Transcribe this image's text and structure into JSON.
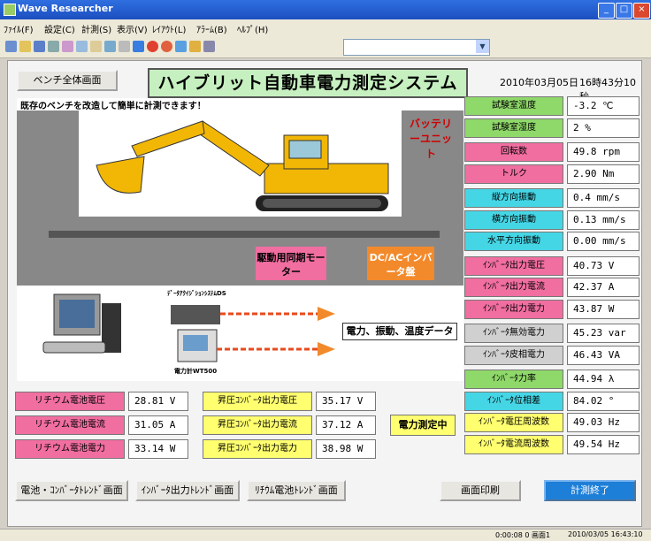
{
  "window": {
    "title": "Wave Researcher",
    "minimize": "_",
    "maximize": "□",
    "close": "×"
  },
  "menu": [
    "ﾌｧｲﾙ(F)",
    "設定(C)",
    "計測(S)",
    "表示(V)",
    "ﾚｲｱｳﾄ(L)",
    "ｱﾗｰﾑ(B)",
    "ﾍﾙﾌﾟ(H)"
  ],
  "toolbar": {
    "combo_arrow": "▼"
  },
  "header": {
    "bench_button": "ベンチ全体画面",
    "system_title": "ハイブリット自動車電力測定システム",
    "date": "2010年03月05日",
    "time": "16時43分10秒"
  },
  "diagram": {
    "caption": "既存のベンチを改造して簡単に計測できます！",
    "battery_label": "バッテリーユニット",
    "motor_label": "駆動用同期モーター",
    "inverter_label": "DC/ACインバータ盤",
    "recorder_label": "ﾃﾞｰﾀｱｸｲｼﾞｼｮﾝｼｽﾃﾑDS",
    "power_meter_label": "電力計WT500",
    "data_label": "電力、振動、温度データ"
  },
  "colors": {
    "pink": "#f06ea0",
    "cyan": "#45d6e6",
    "green": "#8fd86a",
    "yellow": "#ffff70",
    "orange": "#f28a2c",
    "start_button": "#1e7fd8"
  },
  "measurements": [
    {
      "label": "試験室温度",
      "value": "-3.2  ℃",
      "color": "green"
    },
    {
      "label": "試験室湿度",
      "value": "2  %",
      "color": "green"
    },
    {
      "label": "回転数",
      "value": "49.8  rpm",
      "color": "pink"
    },
    {
      "label": "トルク",
      "value": "2.90  Nm",
      "color": "pink"
    },
    {
      "label": "縦方向振動",
      "value": "0.4  mm/s",
      "color": "cyan"
    },
    {
      "label": "横方向振動",
      "value": "0.13  mm/s",
      "color": "cyan"
    },
    {
      "label": "水平方向振動",
      "value": "0.00  mm/s",
      "color": "cyan"
    },
    {
      "label": "ｲﾝﾊﾞｰﾀ出力電圧",
      "value": "40.73  V",
      "color": "pink"
    },
    {
      "label": "ｲﾝﾊﾞｰﾀ出力電流",
      "value": "42.37  A",
      "color": "pink"
    },
    {
      "label": "ｲﾝﾊﾞｰﾀ出力電力",
      "value": "43.87  W",
      "color": "pink"
    },
    {
      "label": "ｲﾝﾊﾞｰﾀ無効電力",
      "value": "45.23  var",
      "color": "grey"
    },
    {
      "label": "ｲﾝﾊﾞｰﾀ皮相電力",
      "value": "46.43  VA",
      "color": "grey"
    },
    {
      "label": "ｲﾝﾊﾞｰﾀ力率",
      "value": "44.94  λ",
      "color": "green"
    },
    {
      "label": "ｲﾝﾊﾞｰﾀ位相差",
      "value": "84.02  °",
      "color": "cyan"
    },
    {
      "label": "ｲﾝﾊﾞｰﾀ電圧周波数",
      "value": "49.03  Hz",
      "color": "yellow"
    },
    {
      "label": "ｲﾝﾊﾞｰﾀ電流周波数",
      "value": "49.54  Hz",
      "color": "yellow"
    }
  ],
  "battery_values": [
    {
      "label": "リチウム電池電圧",
      "value": "28.81  V"
    },
    {
      "label": "リチウム電池電流",
      "value": "31.05  A"
    },
    {
      "label": "リチウム電池電力",
      "value": "33.14  W"
    }
  ],
  "converter_values": [
    {
      "label": "昇圧ｺﾝﾊﾞｰﾀ出力電圧",
      "value": "35.17  V"
    },
    {
      "label": "昇圧ｺﾝﾊﾞｰﾀ出力電流",
      "value": "37.12  A"
    },
    {
      "label": "昇圧ｺﾝﾊﾞｰﾀ出力電力",
      "value": "38.98  W"
    }
  ],
  "status_indicator": "電力測定中",
  "footer": {
    "btn_battery_trend": "電池・ｺﾝﾊﾞｰﾀﾄﾚﾝﾄﾞ画面",
    "btn_inverter_trend": "ｲﾝﾊﾞｰﾀ出力ﾄﾚﾝﾄﾞ画面",
    "btn_lithium_trend": "ﾘﾁｳﾑ電池ﾄﾚﾝﾄﾞ画面",
    "btn_print": "画面印刷",
    "btn_stop": "計測終了"
  },
  "statusbar": {
    "left": "0:00:08  0  画面1",
    "right": "2010/03/05  16:43:10"
  }
}
